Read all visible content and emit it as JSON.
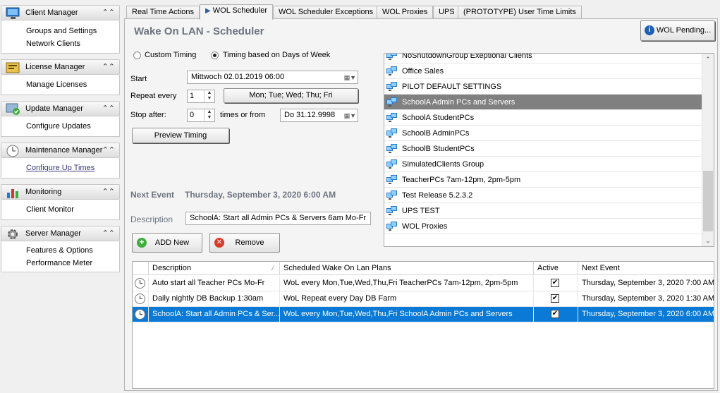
{
  "sidebar": {
    "groups": [
      {
        "title": "Client Manager",
        "icon": "monitor-icon",
        "items": [
          "Groups and Settings",
          "Network Clients"
        ]
      },
      {
        "title": "License Manager",
        "icon": "license-icon",
        "items": [
          "Manage Licenses"
        ]
      },
      {
        "title": "Update  Manager",
        "icon": "update-icon",
        "items": [
          "Configure Updates"
        ]
      },
      {
        "title": "Maintenance Manager",
        "icon": "clock-icon",
        "items": [
          "Configure Up Times"
        ]
      },
      {
        "title": "Monitoring",
        "icon": "chart-icon",
        "items": [
          "Client Monitor"
        ]
      },
      {
        "title": "Server Manager",
        "icon": "gear-icon",
        "items": [
          "Features & Options",
          "Performance Meter"
        ]
      }
    ]
  },
  "tabs": [
    "Real Time Actions",
    "WOL Scheduler",
    "WOL Scheduler Exceptions",
    "WOL Proxies",
    "UPS",
    "(PROTOTYPE) User Time Limits"
  ],
  "active_tab": "WOL Scheduler",
  "scheduler": {
    "title": "Wake On LAN - Scheduler",
    "wol_pending_label": "WOL Pending...",
    "timing": {
      "custom_label": "Custom Timing",
      "days_label": "Timing based on Days of Week",
      "selected": "days"
    },
    "start_label": "Start",
    "start_value": "Mittwoch   02.01.2019  06:00",
    "repeat_label": "Repeat every",
    "repeat_value": "1",
    "days_button": "Mon; Tue; Wed; Thu; Fri",
    "stop_label": "Stop after:",
    "stop_value": "0",
    "times_label": "times or from",
    "stop_date": "Do 31.12.9998",
    "preview_button": "Preview Timing",
    "next_event_label": "Next Event",
    "next_event_value": "Thursday, September 3, 2020 6:00 AM",
    "description_label": "Description",
    "description_value": "SchoolA: Start all Admin PCs & Servers 6am Mo-Fr",
    "add_button": "ADD New",
    "remove_button": "Remove"
  },
  "groups_list": [
    {
      "name": "NoShutdownGroup Exeptional Clients",
      "selected": false
    },
    {
      "name": "Office Sales",
      "selected": false
    },
    {
      "name": "PILOT DEFAULT SETTINGS",
      "selected": false
    },
    {
      "name": "SchoolA Admin PCs and Servers",
      "selected": true
    },
    {
      "name": "SchoolA StudentPCs",
      "selected": false
    },
    {
      "name": "SchoolB AdminPCs",
      "selected": false
    },
    {
      "name": "SchoolB StudentPCs",
      "selected": false
    },
    {
      "name": "SimulatedClients Group",
      "selected": false
    },
    {
      "name": "TeacherPCs 7am-12pm, 2pm-5pm",
      "selected": false
    },
    {
      "name": "Test Release 5.2.3.2",
      "selected": false
    },
    {
      "name": "UPS TEST",
      "selected": false
    },
    {
      "name": "WOL Proxies",
      "selected": false
    }
  ],
  "table": {
    "columns": [
      "Description",
      "Scheduled Wake On Lan Plans",
      "Active",
      "Next Event"
    ],
    "rows": [
      {
        "description": "Auto start all Teacher PCs Mo-Fr",
        "plan": "WoL  every Mon,Tue,Wed,Thu,Fri  TeacherPCs 7am-12pm, 2pm-5pm",
        "active": true,
        "next": "Thursday, September 3, 2020 7:00 AM",
        "selected": false
      },
      {
        "description": "Daily nightly DB Backup 1:30am",
        "plan": "WoL  Repeat every Day DB Farm",
        "active": true,
        "next": "Thursday, September 3, 2020 1:30 AM",
        "selected": false
      },
      {
        "description": "SchoolA: Start all Admin PCs & Ser...",
        "plan": "WoL  every Mon,Tue,Wed,Thu,Fri  SchoolA Admin PCs and Servers",
        "active": true,
        "next": "Thursday, September 3, 2020 6:00 AM",
        "selected": true
      }
    ]
  },
  "colors": {
    "accent": "#0a7ad6",
    "list_selection": "#808080",
    "title": "#6d7480"
  }
}
